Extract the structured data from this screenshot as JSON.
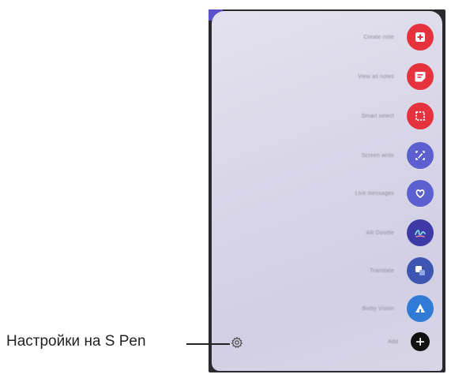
{
  "callout": {
    "label": "Настройки на S Pen"
  },
  "panel": {
    "items": [
      {
        "label": "Create note",
        "icon": "create-note-icon",
        "color": "#e5323c"
      },
      {
        "label": "View all notes",
        "icon": "view-notes-icon",
        "color": "#e5323c"
      },
      {
        "label": "Smart select",
        "icon": "smart-select-icon",
        "color": "#e5323c"
      },
      {
        "label": "Screen write",
        "icon": "screen-write-icon",
        "color": "#5b5fd0"
      },
      {
        "label": "Live messages",
        "icon": "live-messages-icon",
        "color": "#5b5fd0"
      },
      {
        "label": "AR Doodle",
        "icon": "ar-doodle-icon",
        "color": "#3d3aa8"
      },
      {
        "label": "Translate",
        "icon": "translate-icon",
        "color": "#3d56b2"
      },
      {
        "label": "Bixby Vision",
        "icon": "bixby-vision-icon",
        "color": "#2f7bd6"
      },
      {
        "label": "Add",
        "icon": "add-icon",
        "color": "#111111"
      }
    ]
  }
}
